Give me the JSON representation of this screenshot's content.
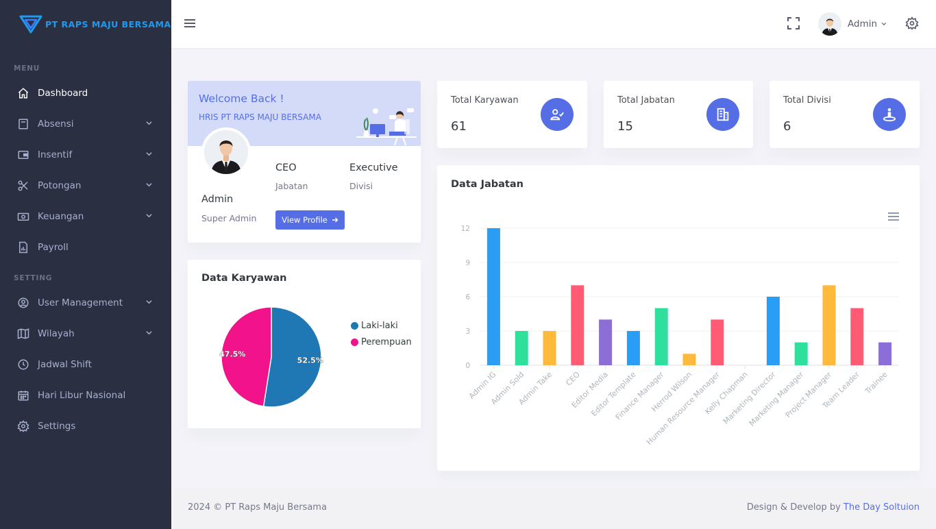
{
  "brand": {
    "name": "PT RAPS MAJU BERSAMA"
  },
  "sidebar": {
    "menu_title": "MENU",
    "setting_title": "SETTING",
    "items": [
      {
        "label": "Dashboard",
        "icon": "home-icon",
        "has_children": false,
        "active": true
      },
      {
        "label": "Absensi",
        "icon": "calendar-icon",
        "has_children": true
      },
      {
        "label": "Insentif",
        "icon": "wallet-icon",
        "has_children": true
      },
      {
        "label": "Potongan",
        "icon": "scissors-icon",
        "has_children": true
      },
      {
        "label": "Keuangan",
        "icon": "money-icon",
        "has_children": true
      },
      {
        "label": "Payroll",
        "icon": "report-icon",
        "has_children": false
      }
    ],
    "settings": [
      {
        "label": "User Management",
        "icon": "user-circle-icon",
        "has_children": true
      },
      {
        "label": "Wilayah",
        "icon": "map-icon",
        "has_children": true
      },
      {
        "label": "Jadwal Shift",
        "icon": "clock-icon",
        "has_children": false
      },
      {
        "label": "Hari Libur Nasional",
        "icon": "calendar-grid-icon",
        "has_children": false
      },
      {
        "label": "Settings",
        "icon": "gear-icon",
        "has_children": false
      }
    ]
  },
  "topbar": {
    "user_name": "Admin"
  },
  "profile": {
    "welcome": "Welcome Back !",
    "subtitle": "HRIS PT RAPS MAJU BERSAMA",
    "name": "Admin",
    "role": "Super Admin",
    "jabatan_value": "CEO",
    "jabatan_label": "Jabatan",
    "divisi_value": "Executive",
    "divisi_label": "Divisi",
    "button": "View Profile"
  },
  "stats": [
    {
      "title": "Total Karyawan",
      "value": "61",
      "icon": "user-check-icon"
    },
    {
      "title": "Total Jabatan",
      "value": "15",
      "icon": "building-icon"
    },
    {
      "title": "Total Divisi",
      "value": "6",
      "icon": "person-pin-icon"
    }
  ],
  "karyawan": {
    "title": "Data Karyawan",
    "chart_data": {
      "type": "pie",
      "categories": [
        "Laki-laki",
        "Perempuan"
      ],
      "values": [
        52.5,
        47.5
      ],
      "labels": [
        "52.5%",
        "47.5%"
      ],
      "colors": [
        "#1f77b4",
        "#f2138b"
      ],
      "legend_position": "right"
    }
  },
  "jabatan": {
    "title": "Data Jabatan",
    "chart_data": {
      "type": "bar",
      "categories": [
        "Admin IG",
        "Admin Sold",
        "Admin Take",
        "CEO",
        "Editor Media",
        "Editor Template",
        "Finance Manager",
        "Herrod Wilson",
        "Human Resource Manager",
        "Kelly Chapman",
        "Marketing Director",
        "Marketing Manager",
        "Project Manager",
        "Team Leader",
        "Trainee"
      ],
      "values": [
        12,
        3,
        3,
        7,
        4,
        3,
        5,
        1,
        4,
        0,
        6,
        2,
        7,
        5,
        2
      ],
      "colors": [
        "#2a9df4",
        "#2ee09c",
        "#ffba3b",
        "#ff5b75",
        "#8b6fd6"
      ],
      "y_ticks": [
        0,
        3,
        6,
        9,
        12
      ],
      "ylim": [
        0,
        12
      ],
      "grid": true
    }
  },
  "footer": {
    "left": "2024 © PT Raps Maju Bersama",
    "right_prefix": "Design & Develop by ",
    "right_link": "The Day Soltuion"
  }
}
